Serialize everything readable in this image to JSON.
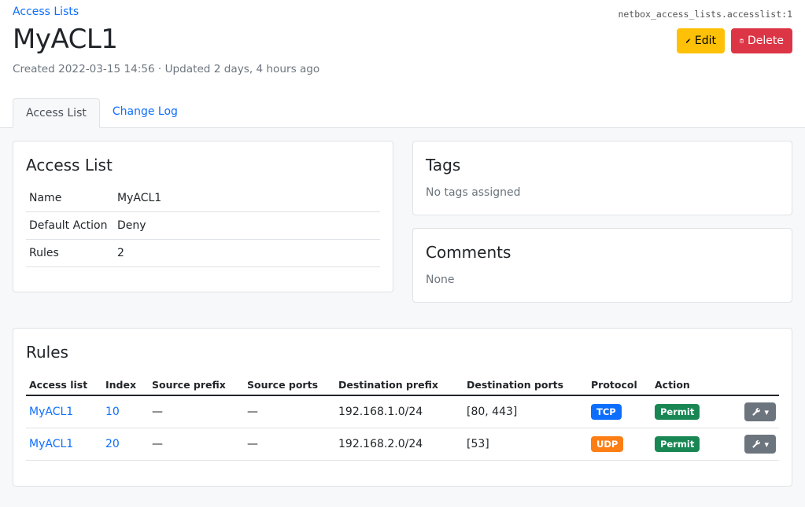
{
  "breadcrumb": "Access Lists",
  "object_id": "netbox_access_lists.accesslist:1",
  "title": "MyACL1",
  "meta": "Created 2022-03-15 14:56 · Updated 2 days, 4 hours ago",
  "actions": {
    "edit": "Edit",
    "delete": "Delete"
  },
  "tabs": [
    {
      "label": "Access List"
    },
    {
      "label": "Change Log"
    }
  ],
  "access_list": {
    "title": "Access List",
    "rows": [
      {
        "key": "Name",
        "value": "MyACL1"
      },
      {
        "key": "Default Action",
        "value": "Deny"
      },
      {
        "key": "Rules",
        "value": "2"
      }
    ]
  },
  "tags": {
    "title": "Tags",
    "empty": "No tags assigned"
  },
  "comments": {
    "title": "Comments",
    "empty": "None"
  },
  "rules": {
    "title": "Rules",
    "columns": [
      "Access list",
      "Index",
      "Source prefix",
      "Source ports",
      "Destination prefix",
      "Destination ports",
      "Protocol",
      "Action"
    ],
    "rows": [
      {
        "access_list": "MyACL1",
        "index": "10",
        "source_prefix": "—",
        "source_ports": "—",
        "destination_prefix": "192.168.1.0/24",
        "destination_ports": "[80, 443]",
        "protocol": "TCP",
        "action": "Permit"
      },
      {
        "access_list": "MyACL1",
        "index": "20",
        "source_prefix": "—",
        "source_ports": "—",
        "destination_prefix": "192.168.2.0/24",
        "destination_ports": "[53]",
        "protocol": "UDP",
        "action": "Permit"
      }
    ]
  },
  "colors": {
    "tcp": "#0d6efd",
    "udp": "#fd7e14",
    "permit": "#198754",
    "edit": "#ffc107",
    "delete": "#dc3545"
  }
}
